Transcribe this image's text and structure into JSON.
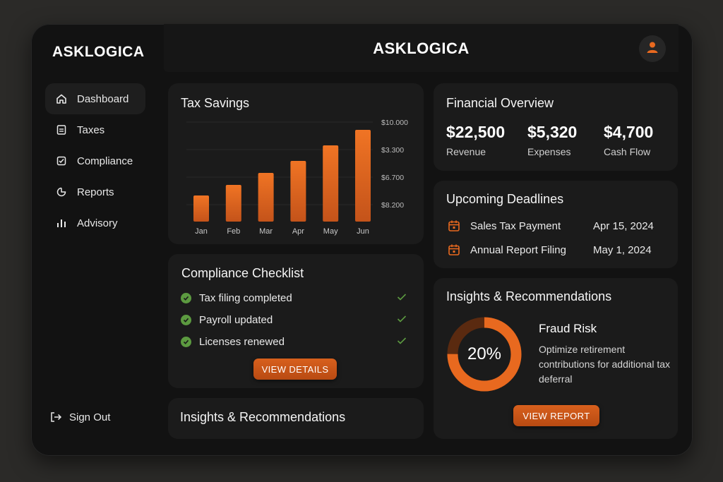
{
  "app": {
    "brand": "ASKLOGICA",
    "title": "ASKLOGICA"
  },
  "colors": {
    "accent": "#e8691f",
    "success": "#5c9a40",
    "background": "#121212",
    "card": "#1b1b1b"
  },
  "sidebar": {
    "items": [
      {
        "label": "Dashboard",
        "icon": "home-icon",
        "active": true
      },
      {
        "label": "Taxes",
        "icon": "document-icon"
      },
      {
        "label": "Compliance",
        "icon": "checklist-icon"
      },
      {
        "label": "Reports",
        "icon": "pie-chart-icon"
      },
      {
        "label": "Advisory",
        "icon": "bar-chart-icon"
      }
    ],
    "signout": {
      "label": "Sign Out",
      "icon": "sign-out-icon"
    }
  },
  "header": {
    "avatar_icon": "user-icon"
  },
  "tax_savings": {
    "title": "Tax Savings",
    "chart_data": {
      "type": "bar",
      "categories": [
        "Jan",
        "Feb",
        "Mar",
        "Apr",
        "May",
        "Jun"
      ],
      "values": [
        37,
        52,
        69,
        86,
        108,
        130
      ],
      "y_tick_labels": [
        "$10.000",
        "$3.300",
        "$6.700",
        "$8.200"
      ],
      "grid": true,
      "color": "#e8691f"
    }
  },
  "compliance": {
    "title": "Compliance Checklist",
    "items": [
      {
        "label": "Tax filing completed"
      },
      {
        "label": "Payroll updated"
      },
      {
        "label": "Licenses renewed"
      }
    ],
    "button": "VIEW DETAILS"
  },
  "insights_left": {
    "title": "Insights & Recommendations"
  },
  "financial": {
    "title": "Financial Overview",
    "metrics": [
      {
        "value": "$22,500",
        "label": "Revenue"
      },
      {
        "value": "$5,320",
        "label": "Expenses"
      },
      {
        "value": "$4,700",
        "label": "Cash Flow"
      }
    ]
  },
  "deadlines": {
    "title": "Upcoming Deadlines",
    "items": [
      {
        "label": "Sales Tax Payment",
        "date": "Apr 15, 2024"
      },
      {
        "label": "Annual Report Filing",
        "date": "May 1, 2024"
      }
    ]
  },
  "insights_right": {
    "title": "Insights & Recommendations",
    "donut_percent": 20,
    "donut_label": "20%",
    "fraud_title": "Fraud Risk",
    "fraud_desc": "Optimize retirement contributions for additional tax deferral",
    "button": "VIEW REPORT"
  }
}
